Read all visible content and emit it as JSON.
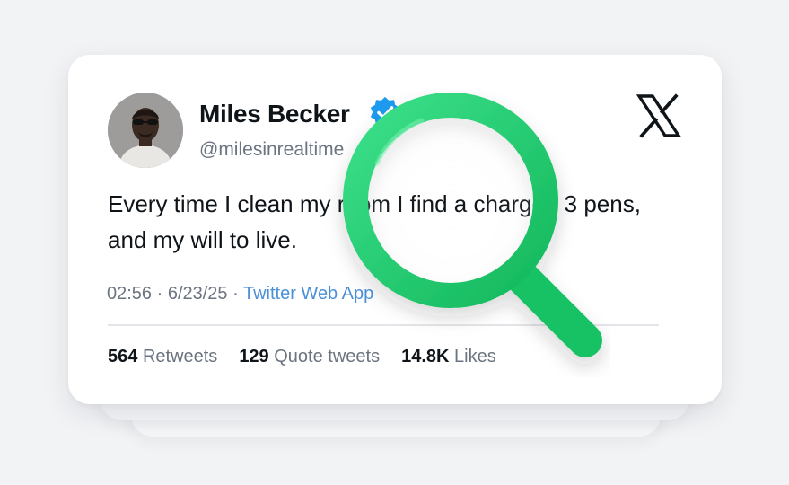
{
  "tweet": {
    "display_name": "Miles Becker",
    "handle": "@milesinrealtime",
    "text": "Every time I clean my room I find a charger, 3 pens, and my will to live.",
    "time_date": "02:56 · 6/23/25 · ",
    "source": "Twitter Web App",
    "retweets_count": "564",
    "retweets_label": "Retweets",
    "quotes_count": "129",
    "quotes_label": "Quote tweets",
    "likes_count": "14.8K",
    "likes_label": "Likes"
  },
  "icons": {
    "verified": "verified-badge-icon",
    "logo": "x-logo-icon",
    "magnifier": "magnifying-glass-icon"
  },
  "colors": {
    "verified_blue": "#1d9bf0",
    "magnifier_green": "#1fcf6c",
    "link_blue": "#4a90d9",
    "muted_text": "#6b7480"
  }
}
